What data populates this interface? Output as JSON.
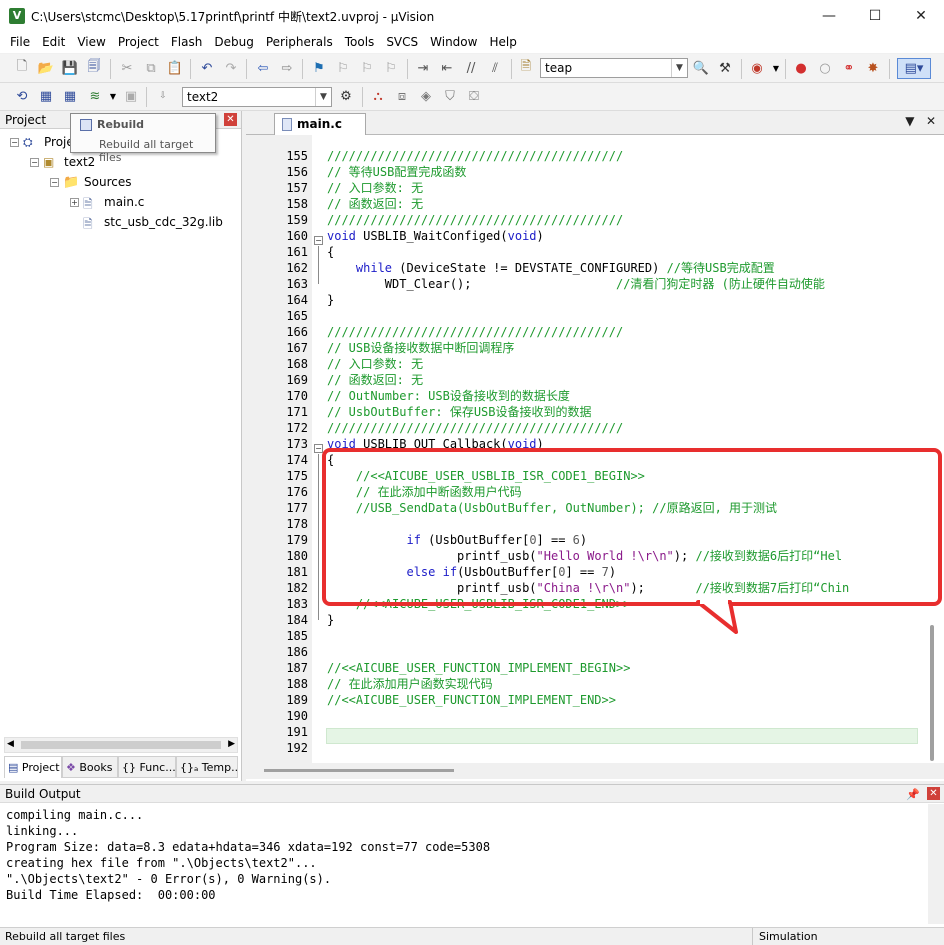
{
  "window": {
    "title": "C:\\Users\\stcmc\\Desktop\\5.17printf\\printf 中断\\text2.uvproj - µVision",
    "app_icon": "V"
  },
  "menu": [
    "File",
    "Edit",
    "View",
    "Project",
    "Flash",
    "Debug",
    "Peripherals",
    "Tools",
    "SVCS",
    "Window",
    "Help"
  ],
  "toolbar1": {
    "find_combo": "teap"
  },
  "toolbar2": {
    "target_combo": "text2"
  },
  "tooltip": {
    "title": "Rebuild",
    "desc": "Rebuild all target files"
  },
  "project_panel": {
    "title": "Project",
    "tree": [
      {
        "label": "Proje",
        "icon": "project-icon"
      },
      {
        "label": "text2",
        "icon": "target-icon"
      },
      {
        "label": "Sources",
        "icon": "folder-icon"
      },
      {
        "label": "main.c",
        "icon": "file-icon"
      },
      {
        "label": "stc_usb_cdc_32g.lib",
        "icon": "file-icon"
      }
    ],
    "tabs": [
      "Project",
      "Books",
      "{} Func...",
      "{}ₐ Temp..."
    ]
  },
  "editor": {
    "tab": "main.c",
    "lines": [
      {
        "n": "155",
        "parts": [
          {
            "c": "cmt",
            "t": "/////////////////////////////////////////"
          }
        ]
      },
      {
        "n": "156",
        "parts": [
          {
            "c": "cmt",
            "t": "// 等待USB配置完成函数"
          }
        ]
      },
      {
        "n": "157",
        "parts": [
          {
            "c": "cmt",
            "t": "// 入口参数: 无"
          }
        ]
      },
      {
        "n": "158",
        "parts": [
          {
            "c": "cmt",
            "t": "// 函数返回: 无"
          }
        ]
      },
      {
        "n": "159",
        "parts": [
          {
            "c": "cmt",
            "t": "/////////////////////////////////////////"
          }
        ]
      },
      {
        "n": "160",
        "parts": [
          {
            "c": "kw",
            "t": "void"
          },
          {
            "c": "",
            "t": " USBLIB_WaitConfiged("
          },
          {
            "c": "kw",
            "t": "void"
          },
          {
            "c": "",
            "t": ")"
          }
        ]
      },
      {
        "n": "161",
        "parts": [
          {
            "c": "",
            "t": "{"
          }
        ]
      },
      {
        "n": "162",
        "parts": [
          {
            "c": "",
            "t": "    "
          },
          {
            "c": "kw",
            "t": "while"
          },
          {
            "c": "",
            "t": " (DeviceState != DEVSTATE_CONFIGURED) "
          },
          {
            "c": "cmt",
            "t": "//等待USB完成配置"
          }
        ]
      },
      {
        "n": "163",
        "parts": [
          {
            "c": "",
            "t": "        WDT_Clear();                    "
          },
          {
            "c": "cmt",
            "t": "//清看门狗定时器 (防止硬件自动使能"
          }
        ]
      },
      {
        "n": "164",
        "parts": [
          {
            "c": "",
            "t": "}"
          }
        ]
      },
      {
        "n": "165",
        "parts": []
      },
      {
        "n": "166",
        "parts": [
          {
            "c": "cmt",
            "t": "/////////////////////////////////////////"
          }
        ]
      },
      {
        "n": "167",
        "parts": [
          {
            "c": "cmt",
            "t": "// USB设备接收数据中断回调程序"
          }
        ]
      },
      {
        "n": "168",
        "parts": [
          {
            "c": "cmt",
            "t": "// 入口参数: 无"
          }
        ]
      },
      {
        "n": "169",
        "parts": [
          {
            "c": "cmt",
            "t": "// 函数返回: 无"
          }
        ]
      },
      {
        "n": "170",
        "parts": [
          {
            "c": "cmt",
            "t": "// OutNumber: USB设备接收到的数据长度"
          }
        ]
      },
      {
        "n": "171",
        "parts": [
          {
            "c": "cmt",
            "t": "// UsbOutBuffer: 保存USB设备接收到的数据"
          }
        ]
      },
      {
        "n": "172",
        "parts": [
          {
            "c": "cmt",
            "t": "/////////////////////////////////////////"
          }
        ]
      },
      {
        "n": "173",
        "parts": [
          {
            "c": "kw",
            "t": "void"
          },
          {
            "c": "",
            "t": " USBLIB_OUT_Callback("
          },
          {
            "c": "kw",
            "t": "void"
          },
          {
            "c": "",
            "t": ")"
          }
        ]
      },
      {
        "n": "174",
        "parts": [
          {
            "c": "",
            "t": "{"
          }
        ]
      },
      {
        "n": "175",
        "parts": [
          {
            "c": "",
            "t": "    "
          },
          {
            "c": "cmt",
            "t": "//<<AICUBE_USER_USBLIB_ISR_CODE1_BEGIN>>"
          }
        ]
      },
      {
        "n": "176",
        "parts": [
          {
            "c": "",
            "t": "    "
          },
          {
            "c": "cmt",
            "t": "// 在此添加中断函数用户代码"
          }
        ]
      },
      {
        "n": "177",
        "parts": [
          {
            "c": "",
            "t": "    "
          },
          {
            "c": "cmt",
            "t": "//USB_SendData(UsbOutBuffer, OutNumber); //原路返回, 用于测试"
          }
        ]
      },
      {
        "n": "178",
        "parts": []
      },
      {
        "n": "179",
        "parts": [
          {
            "c": "",
            "t": "           "
          },
          {
            "c": "kw",
            "t": "if"
          },
          {
            "c": "",
            "t": " (UsbOutBuffer["
          },
          {
            "c": "num",
            "t": "0"
          },
          {
            "c": "",
            "t": "] == "
          },
          {
            "c": "num",
            "t": "6"
          },
          {
            "c": "",
            "t": ")"
          }
        ]
      },
      {
        "n": "180",
        "parts": [
          {
            "c": "",
            "t": "                  printf_usb("
          },
          {
            "c": "str",
            "t": "\"Hello World !\\r\\n\""
          },
          {
            "c": "",
            "t": "); "
          },
          {
            "c": "cmt",
            "t": "//接收到数据6后打印“Hel"
          }
        ]
      },
      {
        "n": "181",
        "parts": [
          {
            "c": "",
            "t": "           "
          },
          {
            "c": "kw",
            "t": "else if"
          },
          {
            "c": "",
            "t": "(UsbOutBuffer["
          },
          {
            "c": "num",
            "t": "0"
          },
          {
            "c": "",
            "t": "] == "
          },
          {
            "c": "num",
            "t": "7"
          },
          {
            "c": "",
            "t": ")"
          }
        ]
      },
      {
        "n": "182",
        "parts": [
          {
            "c": "",
            "t": "                  printf_usb("
          },
          {
            "c": "str",
            "t": "\"China !\\r\\n\""
          },
          {
            "c": "",
            "t": ");       "
          },
          {
            "c": "cmt",
            "t": "//接收到数据7后打印“Chin"
          }
        ]
      },
      {
        "n": "183",
        "parts": [
          {
            "c": "",
            "t": "    "
          },
          {
            "c": "cmt",
            "t": "//<<AICUBE_USER_USBLIB_ISR_CODE1_END>>"
          }
        ]
      },
      {
        "n": "184",
        "parts": [
          {
            "c": "",
            "t": "}"
          }
        ]
      },
      {
        "n": "185",
        "parts": []
      },
      {
        "n": "186",
        "parts": []
      },
      {
        "n": "187",
        "parts": [
          {
            "c": "cmt",
            "t": "//<<AICUBE_USER_FUNCTION_IMPLEMENT_BEGIN>>"
          }
        ]
      },
      {
        "n": "188",
        "parts": [
          {
            "c": "cmt",
            "t": "// 在此添加用户函数实现代码"
          }
        ]
      },
      {
        "n": "189",
        "parts": [
          {
            "c": "cmt",
            "t": "//<<AICUBE_USER_FUNCTION_IMPLEMENT_END>>"
          }
        ]
      },
      {
        "n": "190",
        "parts": []
      },
      {
        "n": "191",
        "parts": []
      },
      {
        "n": "192",
        "parts": []
      }
    ]
  },
  "build_output": {
    "title": "Build Output",
    "lines": [
      "compiling main.c...",
      "linking...",
      "Program Size: data=8.3 edata+hdata=346 xdata=192 const=77 code=5308",
      "creating hex file from \".\\Objects\\text2\"...",
      "\".\\Objects\\text2\" - 0 Error(s), 0 Warning(s).",
      "Build Time Elapsed:  00:00:00"
    ]
  },
  "status": {
    "left": "Rebuild all target files",
    "right": "Simulation"
  },
  "colors": {
    "annotation": "#e82e2e",
    "comment": "#1e9a2e",
    "keyword": "#1c1cc8",
    "string": "#8a1a8a"
  }
}
